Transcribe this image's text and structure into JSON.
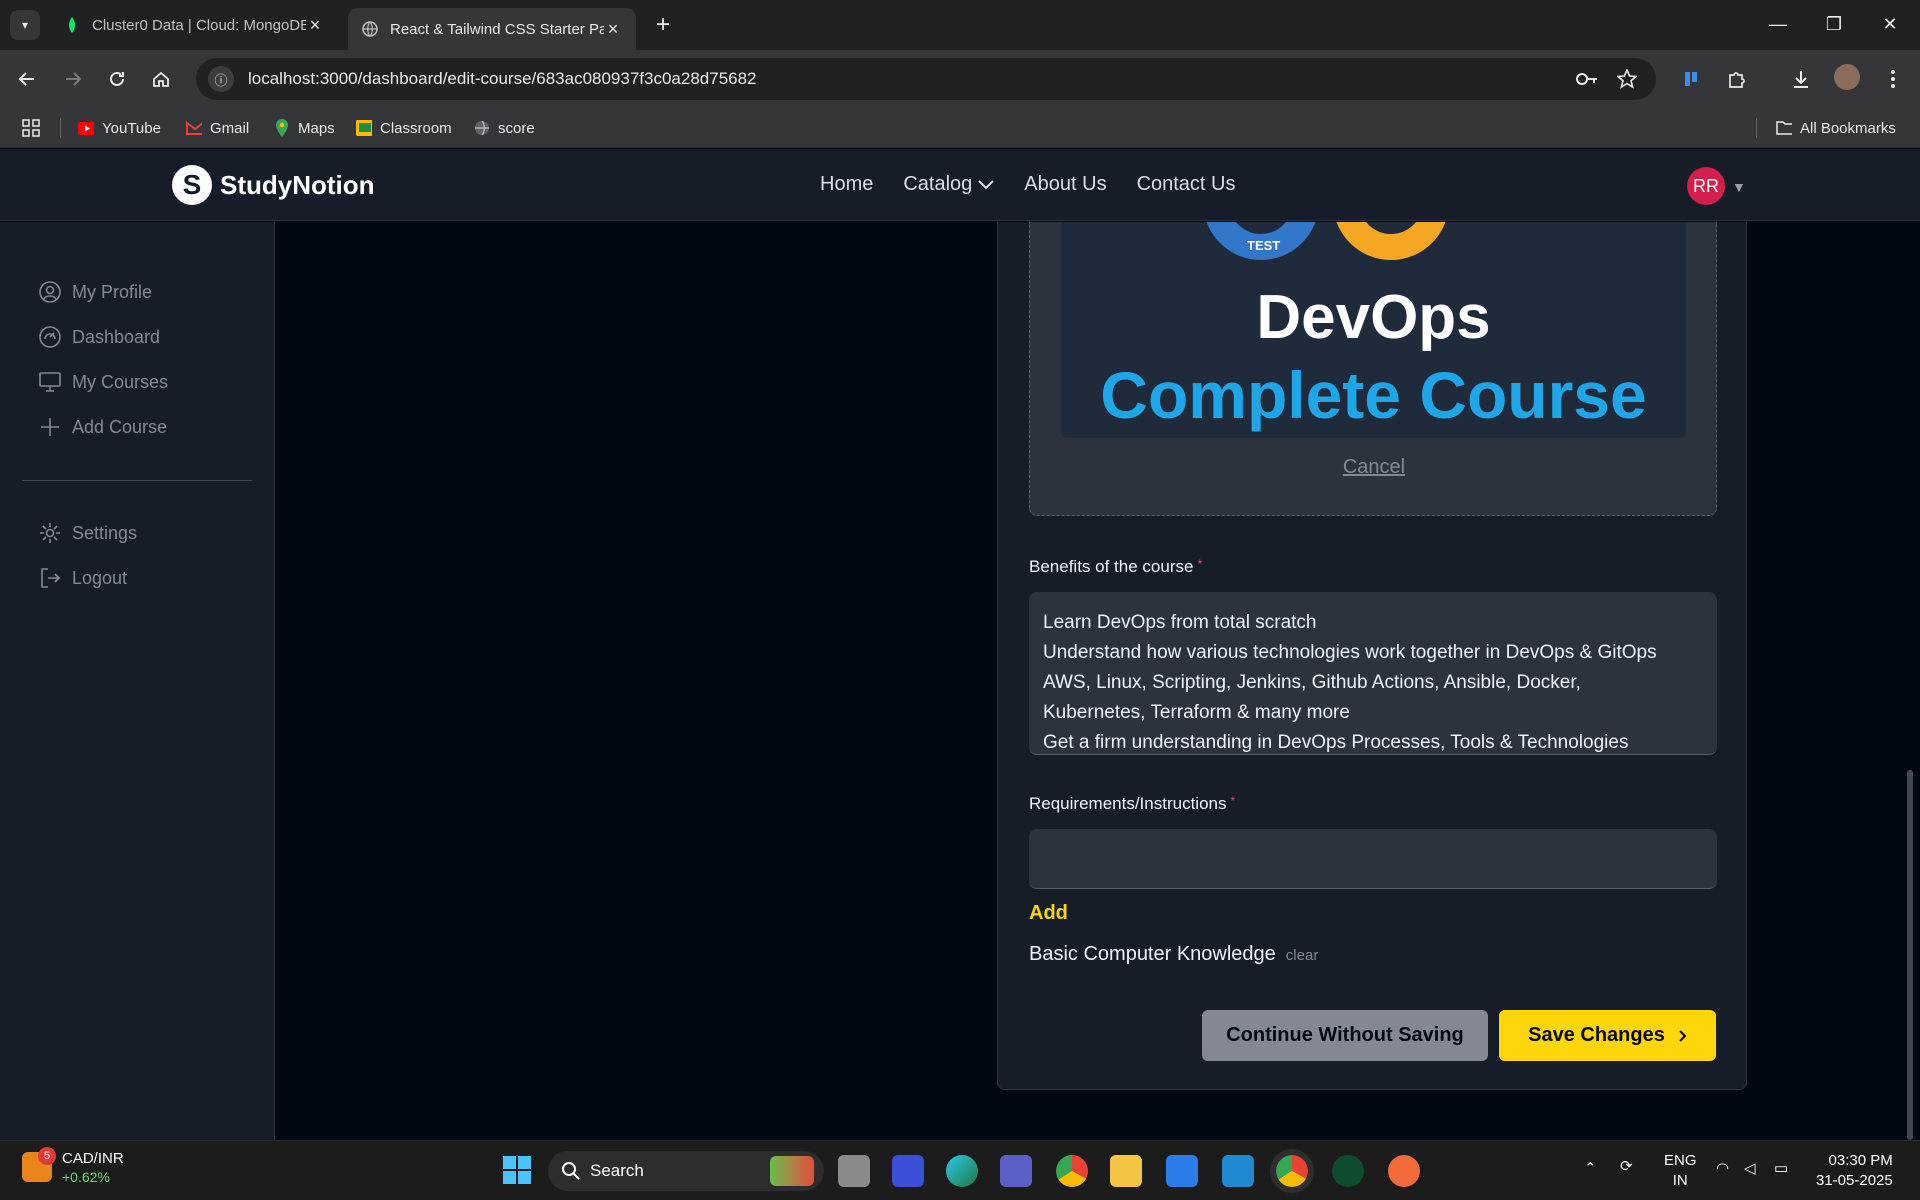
{
  "browser": {
    "tabs": [
      {
        "title": "Cluster0 Data | Cloud: MongoDB",
        "active": false
      },
      {
        "title": "React & Tailwind CSS Starter Pa",
        "active": true
      }
    ],
    "url": "localhost:3000/dashboard/edit-course/683ac080937f3c0a28d75682",
    "bookmarks": [
      "YouTube",
      "Gmail",
      "Maps",
      "Classroom",
      "score"
    ],
    "all_bookmarks": "All Bookmarks"
  },
  "navbar": {
    "logo_letter": "S",
    "brand": "StudyNotion",
    "links": [
      "Home",
      "Catalog",
      "About Us",
      "Contact Us"
    ],
    "avatar": "RR"
  },
  "sidebar": {
    "items": [
      "My Profile",
      "Dashboard",
      "My Courses",
      "Add Course"
    ],
    "bottom_items": [
      "Settings",
      "Logout"
    ]
  },
  "form": {
    "thumbnail_text_1": "DevOps",
    "thumbnail_text_2": "Complete Course",
    "thumbnail_badge": "TEST",
    "cancel": "Cancel",
    "benefits_label": "Benefits of the course",
    "required_mark": "*",
    "benefits_lines": [
      "Learn DevOps from total scratch",
      "Understand how various technologies work together in DevOps & GitOps",
      "AWS, Linux, Scripting, Jenkins, Github Actions, Ansible, Docker,",
      "Kubernetes, Terraform & many more",
      "Get a firm understanding in DevOps Processes, Tools & Technologies"
    ],
    "requirements_label": "Requirements/Instructions",
    "requirements_value": "",
    "add": "Add",
    "requirements_list": [
      "Basic Computer Knowledge"
    ],
    "clear": "clear",
    "continue_button": "Continue Without Saving",
    "save_button": "Save Changes"
  },
  "taskbar": {
    "widget_pair": "CAD/INR",
    "widget_change": "+0.62%",
    "widget_badge": "5",
    "search": "Search",
    "lang_1": "ENG",
    "lang_2": "IN",
    "time": "03:30 PM",
    "date": "31-05-2025"
  },
  "colors": {
    "accent": "#ffd60a",
    "nav_bg": "#161d29",
    "page_bg": "#000814",
    "required": "#ef476f"
  }
}
